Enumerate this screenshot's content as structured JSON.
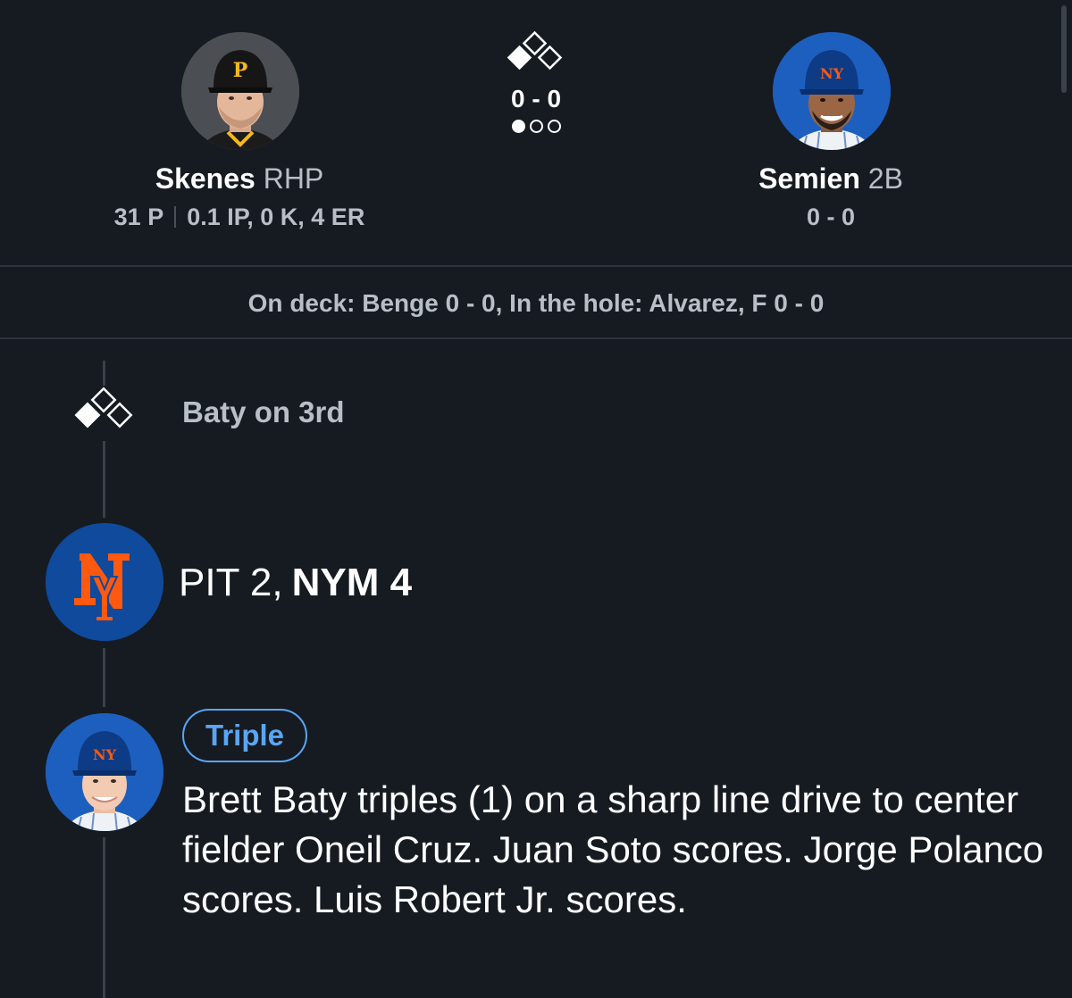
{
  "matchup": {
    "pitcher": {
      "name": "Skenes",
      "position": "RHP",
      "pitches": "31 P",
      "line": "0.1 IP, 0 K, 4 ER",
      "cap_letter": "P"
    },
    "batter": {
      "name": "Semien",
      "position": "2B",
      "line": "0 - 0"
    },
    "count": "0 - 0",
    "outs": 1,
    "bases": {
      "first": false,
      "second": false,
      "third": true
    }
  },
  "due_up": {
    "text": "On deck: Benge 0 - 0, In the hole: Alvarez, F 0 - 0"
  },
  "timeline": {
    "runner_event": {
      "text": "Baty on 3rd",
      "bases": {
        "first": false,
        "second": false,
        "third": true
      }
    },
    "score_event": {
      "away": "PIT 2,",
      "home": "NYM 4",
      "logo_icon": "mets-logo-icon"
    },
    "play_event": {
      "tag": "Triple",
      "description": "Brett Baty triples (1) on a sharp line drive to center fielder Oneil Cruz. Juan Soto scores. Jorge Polanco scores. Luis Robert Jr. scores."
    }
  },
  "colors": {
    "background": "#161b21",
    "muted_text": "#b9bfc7",
    "accent_blue": "#5aa5f5",
    "mets_blue": "#0f4a9c",
    "mets_orange": "#ff5910"
  }
}
